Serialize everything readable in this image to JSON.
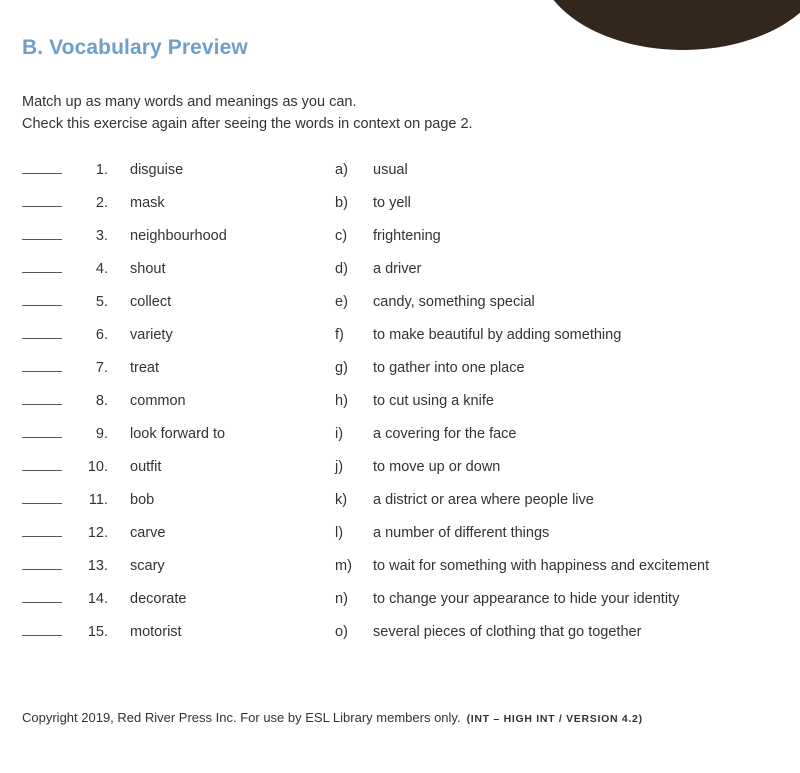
{
  "decor": {
    "corner_blob_color": "#33261d",
    "accent_color": "#6f9fc9"
  },
  "heading": {
    "label": "B. Vocabulary Preview"
  },
  "instructions": {
    "line1": "Match up as many words and meanings as you can.",
    "line2": "Check this exercise again after seeing the words in context on page 2."
  },
  "exercise": {
    "rows": [
      {
        "blank": "",
        "num": "1.",
        "word": "disguise",
        "letter": "a)",
        "definition": "usual"
      },
      {
        "blank": "",
        "num": "2.",
        "word": "mask",
        "letter": "b)",
        "definition": "to yell"
      },
      {
        "blank": "",
        "num": "3.",
        "word": "neighbourhood",
        "letter": "c)",
        "definition": "frightening"
      },
      {
        "blank": "",
        "num": "4.",
        "word": "shout",
        "letter": "d)",
        "definition": "a driver"
      },
      {
        "blank": "",
        "num": "5.",
        "word": "collect",
        "letter": "e)",
        "definition": "candy, something special"
      },
      {
        "blank": "",
        "num": "6.",
        "word": "variety",
        "letter": "f)",
        "definition": "to make beautiful by adding something"
      },
      {
        "blank": "",
        "num": "7.",
        "word": "treat",
        "letter": "g)",
        "definition": "to gather into one place"
      },
      {
        "blank": "",
        "num": "8.",
        "word": "common",
        "letter": "h)",
        "definition": "to cut using a knife"
      },
      {
        "blank": "",
        "num": "9.",
        "word": "look forward to",
        "letter": "i)",
        "definition": "a covering for the face"
      },
      {
        "blank": "",
        "num": "10.",
        "word": "outfit",
        "letter": "j)",
        "definition": "to move up or down"
      },
      {
        "blank": "",
        "num": "11.",
        "word": "bob",
        "letter": "k)",
        "definition": "a district or area where people live"
      },
      {
        "blank": "",
        "num": "12.",
        "word": "carve",
        "letter": "l)",
        "definition": "a number of different things"
      },
      {
        "blank": "",
        "num": "13.",
        "word": "scary",
        "letter": "m)",
        "definition": "to wait for something with happiness and excitement"
      },
      {
        "blank": "",
        "num": "14.",
        "word": "decorate",
        "letter": "n)",
        "definition": "to change your appearance to hide your identity"
      },
      {
        "blank": "",
        "num": "15.",
        "word": "motorist",
        "letter": "o)",
        "definition": "several pieces of clothing that go together"
      }
    ]
  },
  "footer": {
    "copyright": "Copyright 2019, Red River Press Inc. For use by ESL Library members only.",
    "version": "(INT – HIGH INT / VERSION 4.2)"
  }
}
